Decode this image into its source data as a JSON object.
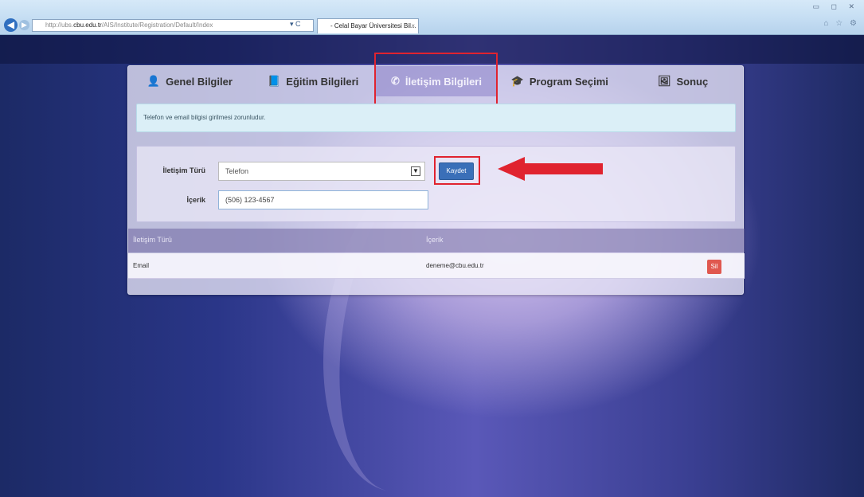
{
  "browser": {
    "url_prefix": "http://ubs.",
    "url_domain": "cbu.edu.tr",
    "url_path": "/AIS/Institute/Registration/Default/Index",
    "tab_title": "- Celal Bayar Üniversitesi Bil...",
    "tab_close": "×",
    "address_controls": "▾ C",
    "window_controls": "▭ ◻ ✕",
    "toolbar_icons": "⌂ ☆ ⚙"
  },
  "tabs": [
    {
      "label": "Genel Bilgiler",
      "icon": "user-icon",
      "glyph": "👤"
    },
    {
      "label": "Eğitim Bilgileri",
      "icon": "book-icon",
      "glyph": "📘"
    },
    {
      "label": "İletişim Bilgileri",
      "icon": "phone-icon",
      "glyph": "✆"
    },
    {
      "label": "Program Seçimi",
      "icon": "graduation-cap-icon",
      "glyph": "🎓"
    },
    {
      "label": "Sonuç",
      "icon": "picture-icon",
      "glyph": "🖼"
    }
  ],
  "active_tab_index": 2,
  "info_message": "Telefon ve email bilgisi girilmesi zorunludur.",
  "form": {
    "type_label": "İletişim Türü",
    "type_value": "Telefon",
    "content_label": "İçerik",
    "content_value": "(506) 123-4567",
    "save_label": "Kaydet",
    "dropdown_glyph": "▼"
  },
  "table": {
    "headers": [
      "İletişim Türü",
      "İçerik"
    ],
    "rows": [
      {
        "type": "Email",
        "content": "deneme@cbu.edu.tr",
        "action": "Sil"
      }
    ]
  },
  "colors": {
    "highlight": "#e0232f",
    "save_button": "#3a6fb8",
    "delete_button": "#e0584f",
    "info_bg": "#dbeff7"
  }
}
